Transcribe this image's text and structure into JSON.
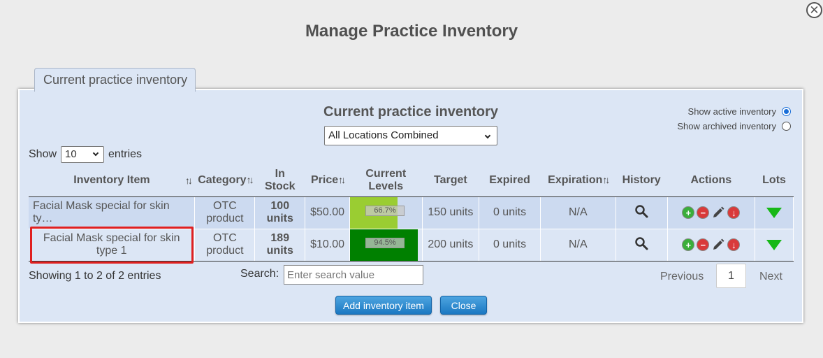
{
  "page_title": "Manage Practice Inventory",
  "tab_label": "Current practice inventory",
  "inner_title": "Current practice inventory",
  "location_select": "All Locations Combined",
  "radios": {
    "active_label": "Show active inventory",
    "archived_label": "Show archived inventory",
    "selected": "active"
  },
  "entries": {
    "show": "Show",
    "value": "10",
    "suffix": "entries"
  },
  "columns": {
    "item": "Inventory Item",
    "category": "Category",
    "in_stock_1": "In",
    "in_stock_2": "Stock",
    "price": "Price",
    "levels_1": "Current",
    "levels_2": "Levels",
    "target": "Target",
    "expired": "Expired",
    "expiration": "Expiration",
    "history": "History",
    "actions": "Actions",
    "lots": "Lots"
  },
  "rows": [
    {
      "item": "Facial Mask special for skin ty…",
      "category_1": "OTC",
      "category_2": "product",
      "stock_1": "100",
      "stock_2": "units",
      "price": "$50.00",
      "level": "66.7%",
      "level_fraction": 0.667,
      "level_color": "#9acd32",
      "target": "150 units",
      "expired": "0 units",
      "expiration": "N/A"
    },
    {
      "item_1": "Facial Mask special for skin",
      "item_2": "type 1",
      "category_1": "OTC",
      "category_2": "product",
      "stock_1": "189",
      "stock_2": "units",
      "price": "$10.00",
      "level": "94.5%",
      "level_fraction": 0.945,
      "level_color": "#008000",
      "target": "200 units",
      "expired": "0 units",
      "expiration": "N/A"
    }
  ],
  "showing": "Showing 1 to 2 of 2 entries",
  "search": {
    "label": "Search:",
    "placeholder": "Enter search value"
  },
  "pagination": {
    "previous": "Previous",
    "page": "1",
    "next": "Next"
  },
  "buttons": {
    "add": "Add inventory item",
    "close": "Close"
  }
}
